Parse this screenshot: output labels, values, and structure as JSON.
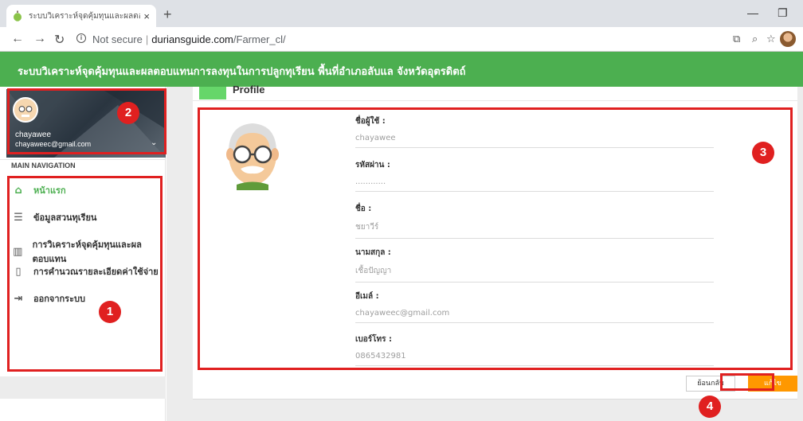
{
  "browser": {
    "tab_title": "ระบบวิเคราะห์จุดคุ้มทุนและผลตอบแทน",
    "url_host": "duriansguide.com",
    "url_path": "/Farmer_cl/",
    "security": "Not secure"
  },
  "app": {
    "header_title": "ระบบวิเคราะห์จุดคุ้มทุนและผลตอบแทนการลงทุนในการปลูกทุเรียน พื้นที่อำเภอลับแล จังหวัดอุตรดิตถ์"
  },
  "sidebar": {
    "user_name": "chayawee",
    "user_email": "chayaweec@gmail.com",
    "nav_title": "MAIN NAVIGATION",
    "items": [
      {
        "label": "หน้าแรก",
        "icon": "home-icon",
        "active": true
      },
      {
        "label": "ข้อมูลสวนทุเรียน",
        "icon": "list-icon",
        "active": false
      },
      {
        "label": "การวิเคราะห์จุดคุ้มทุนและผลตอบแทน",
        "icon": "chart-icon",
        "active": false
      },
      {
        "label": "การคำนวณรายละเอียดค่าใช้จ่าย",
        "icon": "clipboard-icon",
        "active": false
      },
      {
        "label": "ออกจากระบบ",
        "icon": "logout-icon",
        "active": false
      }
    ]
  },
  "profile": {
    "title": "Profile",
    "fields": [
      {
        "label": "ชื่อผู้ใช้ :",
        "value": "chayawee"
      },
      {
        "label": "รหัสผ่าน :",
        "value": "............"
      },
      {
        "label": "ชื่อ :",
        "value": "ชยาวีร์"
      },
      {
        "label": "นามสกุล :",
        "value": "เชื้อปัญญา"
      },
      {
        "label": "อีเมล์ :",
        "value": "chayaweec@gmail.com"
      },
      {
        "label": "เบอร์โทร :",
        "value": "0865432981"
      }
    ],
    "back_label": "ย้อนกลับ",
    "edit_label": "แก้ไข"
  },
  "annotations": [
    "1",
    "2",
    "3",
    "4"
  ],
  "colors": {
    "header_green": "#4caf50",
    "edit_orange": "#ff9800",
    "annotation_red": "#e02020"
  }
}
